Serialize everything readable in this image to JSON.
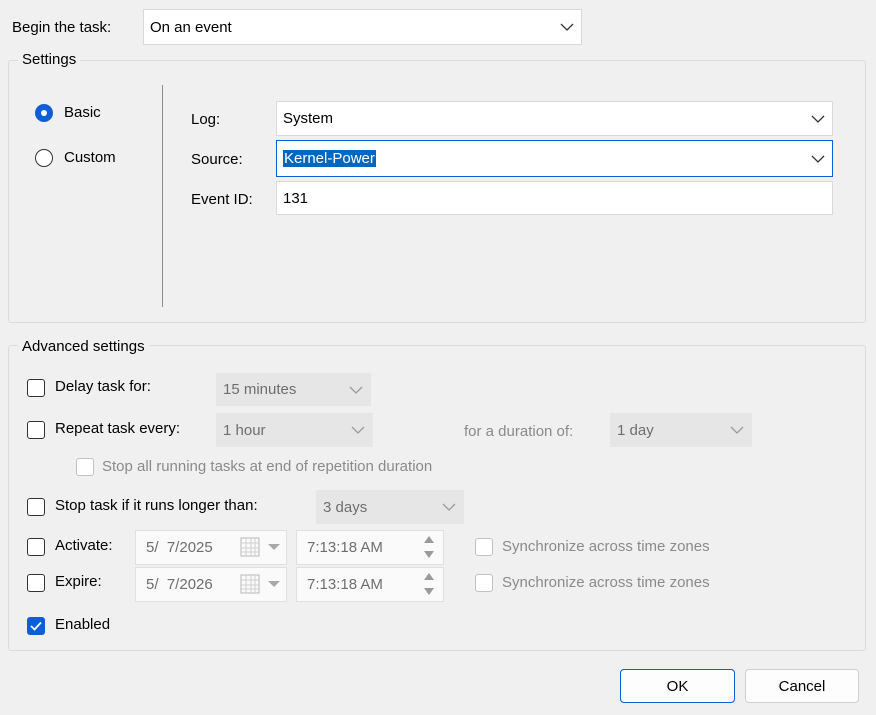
{
  "begin_task": {
    "label": "Begin the task:",
    "value": "On an event"
  },
  "settings": {
    "title": "Settings",
    "radios": [
      {
        "label": "Basic",
        "checked": true
      },
      {
        "label": "Custom",
        "checked": false
      }
    ],
    "log": {
      "label": "Log:",
      "value": "System"
    },
    "source": {
      "label": "Source:",
      "value": "Kernel-Power"
    },
    "event_id": {
      "label": "Event ID:",
      "value": "131"
    }
  },
  "advanced": {
    "title": "Advanced settings",
    "delay": {
      "label": "Delay task for:",
      "value": "15 minutes",
      "checked": false
    },
    "repeat": {
      "label": "Repeat task every:",
      "value": "1 hour",
      "checked": false,
      "duration_label": "for a duration of:",
      "duration_value": "1 day"
    },
    "stop_all": {
      "label": "Stop all running tasks at end of repetition duration",
      "checked": false
    },
    "stop_longer": {
      "label": "Stop task if it runs longer than:",
      "value": "3 days",
      "checked": false
    },
    "activate": {
      "label": "Activate:",
      "date": "5/  7/2025",
      "time": "7:13:18 AM",
      "sync_label": "Synchronize across time zones",
      "checked": false
    },
    "expire": {
      "label": "Expire:",
      "date": "5/  7/2026",
      "time": "7:13:18 AM",
      "sync_label": "Synchronize across time zones",
      "checked": false
    },
    "enabled": {
      "label": "Enabled",
      "checked": true
    }
  },
  "buttons": {
    "ok": "OK",
    "cancel": "Cancel"
  },
  "colors": {
    "accent": "#0f5ed6",
    "selection": "#0067c0",
    "background": "#f0f0f0"
  }
}
